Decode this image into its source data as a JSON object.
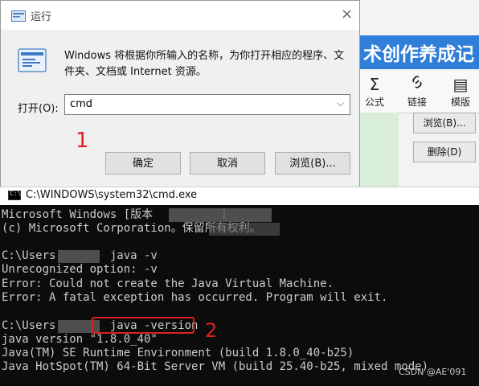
{
  "run_dialog": {
    "title": "运行",
    "close": "×",
    "description": "Windows 将根据你所输入的名称，为你打开相应的程序、文件夹、文档或 Internet 资源。",
    "open_label": "打开(O):",
    "input_value": "cmd",
    "ok_label": "确定",
    "cancel_label": "取消",
    "browse_label": "浏览(B)..."
  },
  "background_app": {
    "banner": "术创作养成记",
    "tools": [
      {
        "icon": "Σ",
        "label": "公式"
      },
      {
        "icon": "🔗",
        "label": "链接"
      },
      {
        "icon": "▤",
        "label": "模版"
      }
    ],
    "browse_button": "浏览(B)...",
    "delete_button": "删除(D)"
  },
  "cmd": {
    "title": "C:\\WINDOWS\\system32\\cmd.exe",
    "icon_text": "C:\\",
    "lines": [
      "Microsoft Windows [版本          ]",
      "(c) Microsoft Corporation。保留所有权利。",
      "",
      "C:\\Users        java -v",
      "Unrecognized option: -v",
      "Error: Could not create the Java Virtual Machine.",
      "Error: A fatal exception has occurred. Program will exit.",
      "",
      "C:\\Users        java -version",
      "java version \"1.8.0_40\"",
      "Java(TM) SE Runtime Environment (build 1.8.0_40-b25)",
      "Java HotSpot(TM) 64-Bit Server VM (build 25.40-b25, mixed mode)"
    ]
  },
  "annotations": {
    "step1": "1",
    "step2": "2"
  },
  "watermark": "CSDN @AE'091"
}
